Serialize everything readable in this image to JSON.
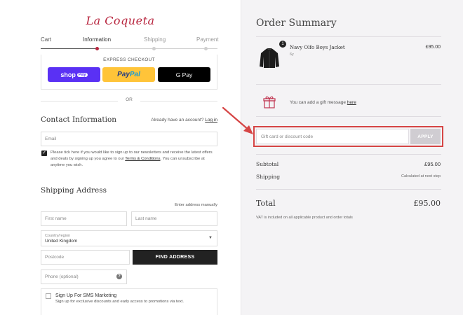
{
  "brand": {
    "logo": "La Coqueta",
    "accent": "#b8253e"
  },
  "steps": [
    {
      "label": "Cart",
      "state": "done"
    },
    {
      "label": "Information",
      "state": "current"
    },
    {
      "label": "Shipping",
      "state": "todo"
    },
    {
      "label": "Payment",
      "state": "todo"
    }
  ],
  "express": {
    "label": "EXPRESS CHECKOUT",
    "shop_pay": {
      "text": "shop",
      "chip": "Pay"
    },
    "paypal": {
      "dark": "Pay",
      "light": "Pal"
    },
    "gpay": "G Pay",
    "or": "OR"
  },
  "contact": {
    "title": "Contact Information",
    "account_prompt": "Already have an account?",
    "login_link": "Log in",
    "email_placeholder": "Email",
    "consent_part1": "Please tick here if you would like to sign up to our newsletters and receive the latest offers and deals by signing up you agree to our",
    "consent_link": "Terms & Conditions",
    "consent_part2": ". You can unsubscribe at anytime you wish."
  },
  "shipping": {
    "title": "Shipping Address",
    "manual_link": "Enter address manually",
    "first_name_placeholder": "First name",
    "last_name_placeholder": "Last name",
    "country_label": "Country/region",
    "country_value": "United Kingdom",
    "postcode_placeholder": "Postcode",
    "find_address": "FIND ADDRESS",
    "phone_placeholder": "Phone (optional)",
    "help_icon": "?",
    "sms_title": "Sign Up For SMS Marketing",
    "sms_sub": "Sign up for exclusive discounts and early access to promotions via text."
  },
  "summary": {
    "title": "Order Summary",
    "item": {
      "name": "Navy Olfo Boys Jacket",
      "size": "6y",
      "price": "£95.00",
      "qty": "1",
      "icon": "jacket-icon"
    },
    "gift_text": "You can add a gift message",
    "gift_link": "here",
    "discount_placeholder": "Gift card or discount code",
    "apply": "APPLY",
    "subtotal_label": "Subtotal",
    "subtotal_value": "£95.00",
    "shipping_label": "Shipping",
    "shipping_value": "Calculated at next step",
    "total_label": "Total",
    "total_value": "£95.00",
    "vat_note": "VAT is included on all applicable product and order totals"
  },
  "annotation": {
    "arrow_color": "#d64545"
  }
}
